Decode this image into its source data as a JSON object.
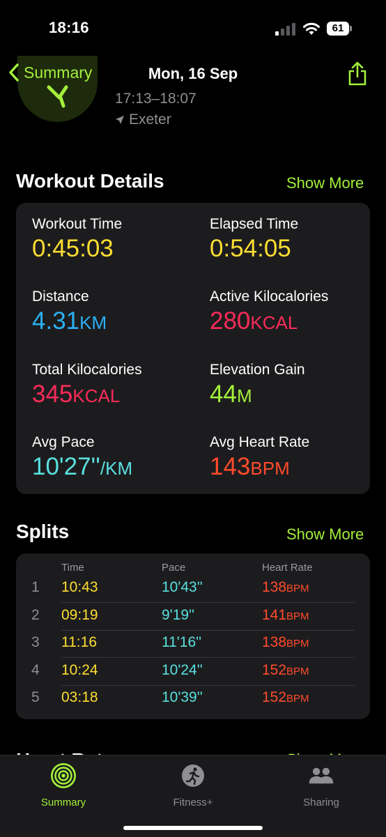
{
  "status": {
    "time": "18:16",
    "battery": "61"
  },
  "nav": {
    "back_label": "Summary",
    "title": "Mon, 16 Sep"
  },
  "header": {
    "time_range": "17:13–18:07",
    "location": "Exeter"
  },
  "workout_details": {
    "title": "Workout Details",
    "show_more": "Show More",
    "metrics": [
      {
        "label": "Workout Time",
        "value": "0:45:03",
        "unit": "",
        "color": "#fede31"
      },
      {
        "label": "Elapsed Time",
        "value": "0:54:05",
        "unit": "",
        "color": "#fede31"
      },
      {
        "label": "Distance",
        "value": "4.31",
        "unit": "KM",
        "color": "#2bb0f5"
      },
      {
        "label": "Active Kilocalories",
        "value": "280",
        "unit": "KCAL",
        "color": "#fb2b5a"
      },
      {
        "label": "Total Kilocalories",
        "value": "345",
        "unit": "KCAL",
        "color": "#fb2b5a"
      },
      {
        "label": "Elevation Gain",
        "value": "44",
        "unit": "M",
        "color": "#a3f03a"
      },
      {
        "label": "Avg Pace",
        "value": "10'27''",
        "unit": "/KM",
        "color": "#5ae0e0"
      },
      {
        "label": "Avg Heart Rate",
        "value": "143",
        "unit": "BPM",
        "color": "#ff4b2b"
      }
    ]
  },
  "splits": {
    "title": "Splits",
    "show_more": "Show More",
    "columns": [
      "Time",
      "Pace",
      "Heart Rate"
    ],
    "rows": [
      {
        "n": "1",
        "time": "10:43",
        "pace": "10'43''",
        "hr": "138",
        "unit": "BPM"
      },
      {
        "n": "2",
        "time": "09:19",
        "pace": "9'19''",
        "hr": "141",
        "unit": "BPM"
      },
      {
        "n": "3",
        "time": "11:16",
        "pace": "11'16''",
        "hr": "138",
        "unit": "BPM"
      },
      {
        "n": "4",
        "time": "10:24",
        "pace": "10'24''",
        "hr": "152",
        "unit": "BPM"
      },
      {
        "n": "5",
        "time": "03:18",
        "pace": "10'39''",
        "hr": "152",
        "unit": "BPM"
      }
    ]
  },
  "next_section": {
    "title": "Heart Rate",
    "show_more": "Show More"
  },
  "tabs": [
    {
      "label": "Summary",
      "icon": "activity-rings-icon",
      "active": true
    },
    {
      "label": "Fitness+",
      "icon": "runner-icon",
      "active": false
    },
    {
      "label": "Sharing",
      "icon": "people-icon",
      "active": false
    }
  ]
}
